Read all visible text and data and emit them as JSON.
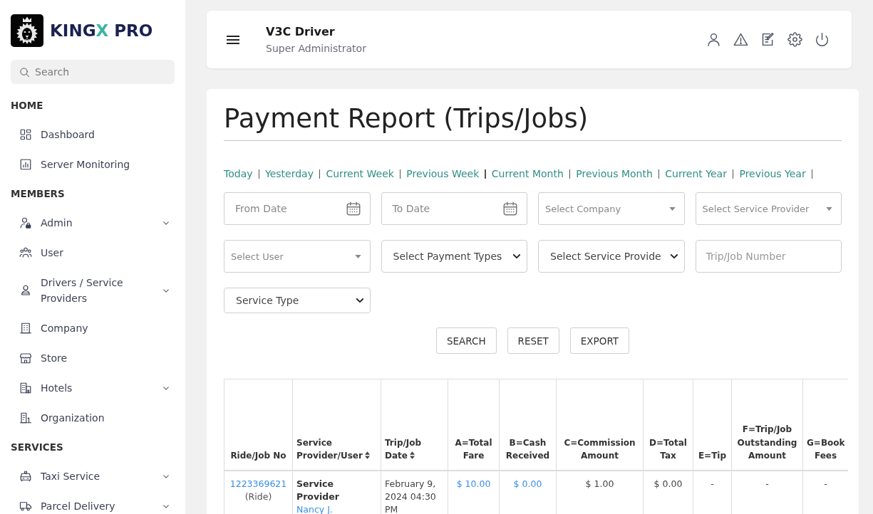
{
  "sidebar": {
    "brand": [
      {
        "text": "KING",
        "color": "#1b2150"
      },
      {
        "text": "X",
        "color": "#3db4a4"
      },
      {
        "text": " PRO",
        "color": "#1b2150"
      }
    ],
    "search": {
      "placeholder": "Search"
    },
    "sections": [
      {
        "heading": "HOME",
        "items": [
          {
            "label": "Dashboard",
            "expandable": false
          },
          {
            "label": "Server Monitoring",
            "expandable": false
          }
        ]
      },
      {
        "heading": "MEMBERS",
        "items": [
          {
            "label": "Admin",
            "expandable": true
          },
          {
            "label": "User",
            "expandable": false
          },
          {
            "label": "Drivers / Service Providers",
            "expandable": true
          },
          {
            "label": "Company",
            "expandable": false
          },
          {
            "label": "Store",
            "expandable": false
          },
          {
            "label": "Hotels",
            "expandable": true
          },
          {
            "label": "Organization",
            "expandable": false
          }
        ]
      },
      {
        "heading": "SERVICES",
        "items": [
          {
            "label": "Taxi Service",
            "expandable": true
          },
          {
            "label": "Parcel Delivery",
            "expandable": true
          }
        ]
      }
    ]
  },
  "header": {
    "title": "V3C Driver",
    "subtitle": "Super Administrator"
  },
  "report": {
    "title": "Payment Report (Trips/Jobs)",
    "quick_ranges": [
      "Today",
      "Yesterday",
      "Current Week",
      "Previous Week",
      "Current Month",
      "Previous Month",
      "Current Year",
      "Previous Year"
    ],
    "filters": [
      {
        "kind": "date",
        "placeholder": "From Date"
      },
      {
        "kind": "date",
        "placeholder": "To Date"
      },
      {
        "kind": "combo",
        "placeholder": "Select Company"
      },
      {
        "kind": "combo",
        "placeholder": "Select Service Provider"
      },
      {
        "kind": "combo",
        "placeholder": "Select User"
      },
      {
        "kind": "select",
        "value": "Select Payment Types"
      },
      {
        "kind": "select",
        "value": "Select Service Provide"
      },
      {
        "kind": "text",
        "placeholder": "Trip/Job Number"
      },
      {
        "kind": "select",
        "value": "Service Type"
      }
    ],
    "buttons": [
      "SEARCH",
      "RESET",
      "EXPORT"
    ],
    "table": {
      "columns": [
        {
          "label": "Ride/Job No",
          "sortable": false
        },
        {
          "label": "Service Provider/User",
          "sortable": true
        },
        {
          "label": "Trip/Job Date",
          "sortable": true
        },
        {
          "label": "A=Total Fare",
          "sortable": false
        },
        {
          "label": "B=Cash Received",
          "sortable": false
        },
        {
          "label": "C=Commission Amount",
          "sortable": false
        },
        {
          "label": "D=Total Tax",
          "sortable": false
        },
        {
          "label": "E=Tip",
          "sortable": false
        },
        {
          "label": "F=Trip/Job Outstanding Amount",
          "sortable": false
        },
        {
          "label": "G=Book Fees",
          "sortable": false
        }
      ],
      "rows": [
        {
          "cells": [
            {
              "kind": "ride",
              "text": "1223369621",
              "note": "(Ride)"
            },
            {
              "kind": "provider",
              "role": "Service Provider",
              "name": "Nancy J."
            },
            {
              "kind": "text",
              "text": "February 9, 2024 04:30 PM"
            },
            {
              "kind": "link",
              "text": "$ 10.00"
            },
            {
              "kind": "link",
              "text": "$ 0.00"
            },
            {
              "kind": "plain",
              "text": "$ 1.00"
            },
            {
              "kind": "plain",
              "text": "$ 0.00"
            },
            {
              "kind": "plain",
              "text": "-"
            },
            {
              "kind": "plain",
              "text": "-"
            },
            {
              "kind": "plain",
              "text": "-"
            }
          ]
        }
      ]
    }
  }
}
